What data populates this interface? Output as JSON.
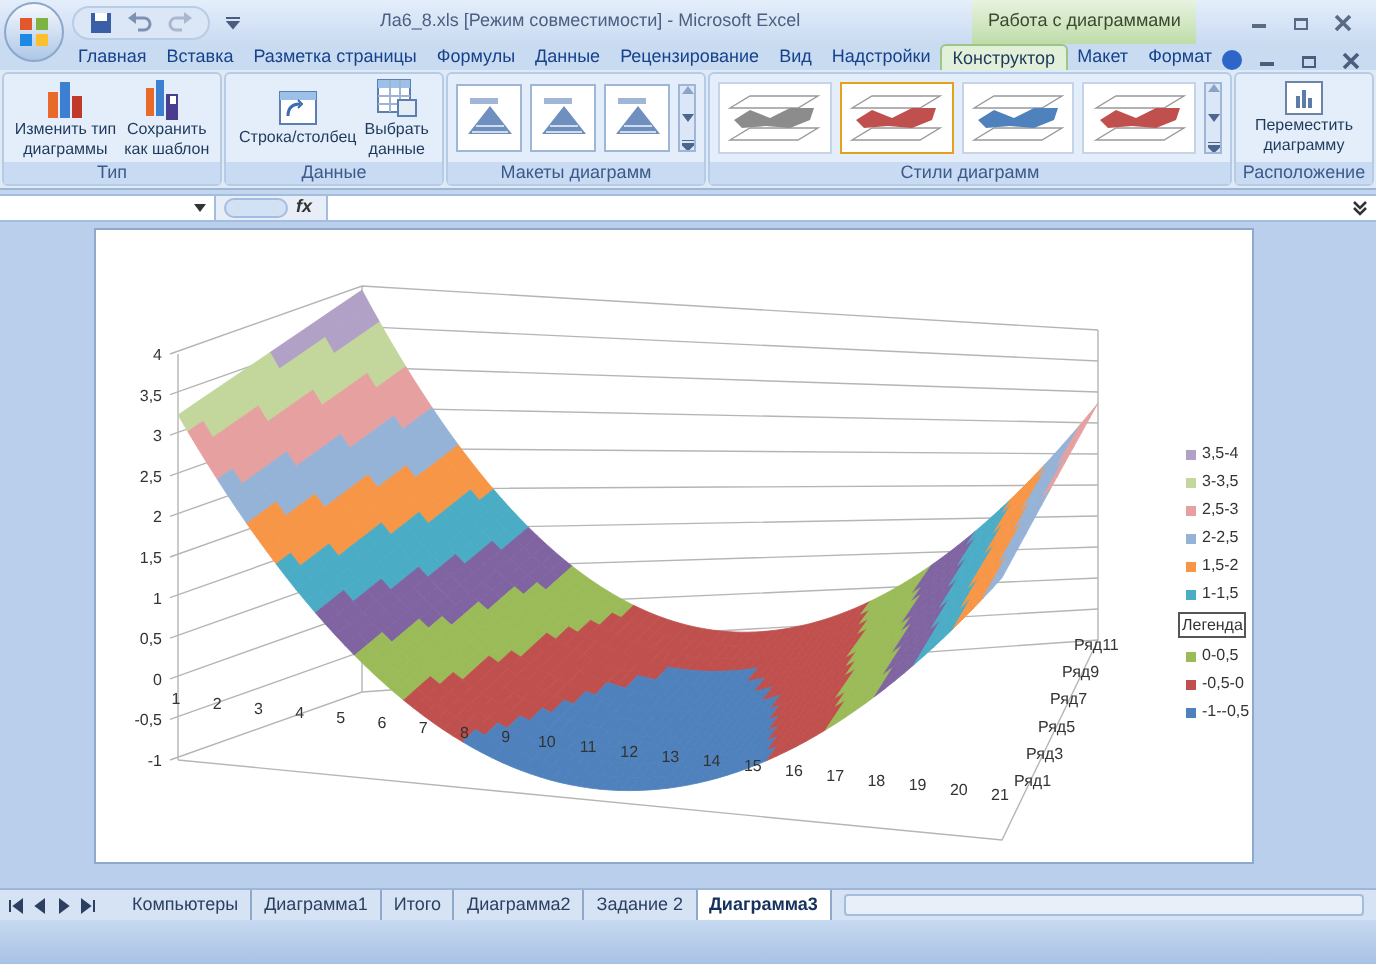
{
  "window": {
    "title": "Ла6_8.xls  [Режим совместимости] - Microsoft Excel",
    "context_title": "Работа с диаграммами"
  },
  "tabs": [
    {
      "label": "Главная",
      "selected": false
    },
    {
      "label": "Вставка",
      "selected": false
    },
    {
      "label": "Разметка страницы",
      "selected": false
    },
    {
      "label": "Формулы",
      "selected": false
    },
    {
      "label": "Данные",
      "selected": false
    },
    {
      "label": "Рецензирование",
      "selected": false
    },
    {
      "label": "Вид",
      "selected": false
    },
    {
      "label": "Надстройки",
      "selected": false
    },
    {
      "label": "Конструктор",
      "selected": true
    },
    {
      "label": "Макет",
      "selected": false
    },
    {
      "label": "Формат",
      "selected": false
    }
  ],
  "ribbon": {
    "groups": [
      {
        "title": "Тип",
        "kind": "buttons",
        "buttons": [
          {
            "kind": "change-type",
            "lines": [
              "Изменить тип",
              "диаграммы"
            ]
          },
          {
            "kind": "save-template",
            "lines": [
              "Сохранить",
              "как шаблон"
            ]
          }
        ]
      },
      {
        "title": "Данные",
        "kind": "buttons",
        "buttons": [
          {
            "kind": "switch",
            "lines": [
              "Строка/столбец"
            ]
          },
          {
            "kind": "select-data",
            "lines": [
              "Выбрать",
              "данные"
            ]
          }
        ]
      },
      {
        "title": "Макеты диаграмм",
        "kind": "layouts",
        "items": [
          {
            "selected": false
          },
          {
            "selected": false
          },
          {
            "selected": false
          }
        ]
      },
      {
        "title": "Стили диаграмм",
        "kind": "styles",
        "items": [
          {
            "color": "#8c8c8c",
            "selected": false
          },
          {
            "color": "#c0504d",
            "selected": true
          },
          {
            "color": "#4f81bd",
            "selected": false
          },
          {
            "color": "#c0504d",
            "selected": false
          }
        ]
      },
      {
        "title": "Расположение",
        "kind": "buttons",
        "buttons": [
          {
            "kind": "move",
            "lines": [
              "Переместить",
              "диаграмму"
            ]
          }
        ]
      }
    ]
  },
  "formula_bar": {
    "fx": "fx"
  },
  "chart": {
    "z_labels": [
      "4",
      "3,5",
      "3",
      "2,5",
      "2",
      "1,5",
      "1",
      "0,5",
      "0",
      "-0,5",
      "-1"
    ],
    "x_labels": [
      "1",
      "2",
      "3",
      "4",
      "5",
      "6",
      "7",
      "8",
      "9",
      "10",
      "11",
      "12",
      "13",
      "14",
      "15",
      "16",
      "17",
      "18",
      "19",
      "20",
      "21"
    ],
    "series_labels": [
      "Ряд1",
      "Ряд3",
      "Ряд5",
      "Ряд7",
      "Ряд9",
      "Ряд11"
    ],
    "legend": [
      {
        "kind": "entry",
        "label": "3,5-4",
        "color": "#b2a1c7"
      },
      {
        "kind": "entry",
        "label": "3-3,5",
        "color": "#c3d69b"
      },
      {
        "kind": "entry",
        "label": "2,5-3",
        "color": "#e6a0a0"
      },
      {
        "kind": "entry",
        "label": "2-2,5",
        "color": "#95b3d7"
      },
      {
        "kind": "entry",
        "label": "1,5-2",
        "color": "#f79646"
      },
      {
        "kind": "entry",
        "label": "1-1,5",
        "color": "#4bacc6"
      },
      {
        "kind": "tooltip",
        "label": "Легенда"
      },
      {
        "kind": "entry",
        "label": "0-0,5",
        "color": "#9bbb59"
      },
      {
        "kind": "entry",
        "label": "-0,5-0",
        "color": "#c0504d"
      },
      {
        "kind": "entry",
        "label": "-1--0,5",
        "color": "#4f81bd"
      }
    ]
  },
  "sheet_tabs": [
    {
      "label": "Компьютеры",
      "selected": false
    },
    {
      "label": "Диаграмма1",
      "selected": false
    },
    {
      "label": "Итого",
      "selected": false
    },
    {
      "label": "Диаграмма2",
      "selected": false
    },
    {
      "label": "Задание 2",
      "selected": false
    },
    {
      "label": "Диаграмма3",
      "selected": true
    }
  ]
}
